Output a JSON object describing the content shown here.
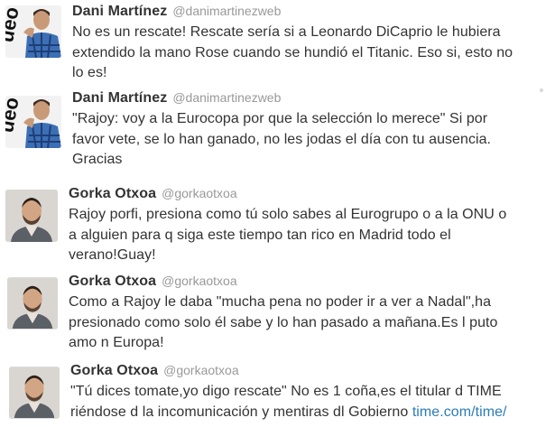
{
  "tweets": [
    {
      "name": "Dani Martínez",
      "handle": "@danimartinezweb",
      "lines": [
        "No es un rescate! Rescate sería si a Leonardo DiCaprio le hubiera",
        "extendido la mano Rose cuando se hundió el Titanic. Eso si, esto no",
        "lo es!"
      ]
    },
    {
      "name": "Dani Martínez",
      "handle": "@danimartinezweb",
      "lines": [
        "\"Rajoy: voy a la Eurocopa por que la selección lo merece\" Si por",
        "favor vete, se lo han ganado, no les jodas el día con tu ausencia.",
        "Gracias"
      ]
    },
    {
      "name": "Gorka Otxoa",
      "handle": "@gorkaotxoa",
      "lines": [
        "Rajoy porfi, presiona como tú solo sabes al Eurogrupo o a la ONU o",
        "a alguien para q siga este tiempo tan rico en Madrid todo el",
        "verano!Guay!"
      ]
    },
    {
      "name": "Gorka Otxoa",
      "handle": "@gorkaotxoa",
      "lines": [
        "Como a Rajoy le daba \"mucha pena no poder ir a ver a Nadal\",ha",
        "presionado como solo él sabe y lo han pasado a mañana.Es l puto",
        "amo n Europa!"
      ]
    },
    {
      "name": "Gorka Otxoa",
      "handle": "@gorkaotxoa",
      "lines": [
        "\"Tú dices tomate,yo digo rescate\" No es 1 coña,es el titular d TIME",
        "riéndose d la incomunicación y mentiras dl Gobierno"
      ],
      "link": "time.com/time/"
    }
  ],
  "avatar_text": "ueo"
}
